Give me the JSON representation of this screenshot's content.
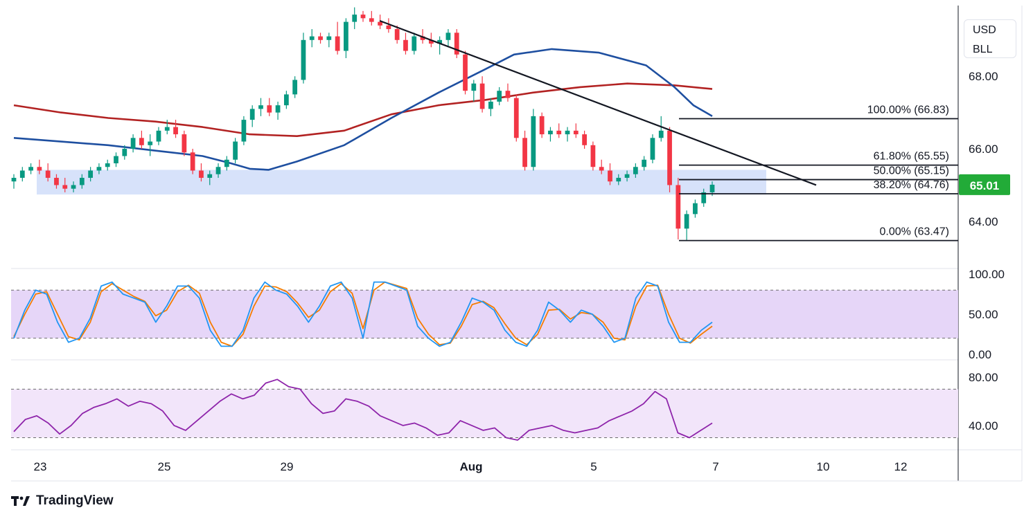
{
  "currency_badge": {
    "line1": "USD",
    "line2": "BLL"
  },
  "brand": {
    "name": "TradingView",
    "logo_icon": "tradingview-logo-icon"
  },
  "colors": {
    "up_candle": "#089981",
    "down_candle": "#f23645",
    "ma_fast": "#1e4fa0",
    "ma_slow": "#b22222",
    "support_zone": "#c9d8f8",
    "stoch_k": "#2196f3",
    "stoch_d": "#f57c00",
    "stoch_band": "#e3d1f7",
    "rsi_line": "#8e24aa",
    "rsi_band": "#f1e4fa",
    "price_label": "#22ab38"
  },
  "chart_data": [
    {
      "type": "candlestick",
      "panel": "price",
      "y_ticks": [
        "68.00",
        "66.00",
        "64.00"
      ],
      "y_range": [
        62.7,
        69.95
      ],
      "x_ticks": [
        "23",
        "25",
        "29",
        "Aug",
        "5",
        "7",
        "10",
        "12"
      ],
      "current_price": {
        "label": "65.01",
        "value": 65.01
      },
      "fib_levels": [
        {
          "label": "100.00% (66.83)",
          "value": 66.83
        },
        {
          "label": "61.80% (65.55)",
          "value": 65.55
        },
        {
          "label": "50.00% (65.15)",
          "value": 65.15
        },
        {
          "label": "38.20% (64.76)",
          "value": 64.76
        },
        {
          "label": "0.00% (63.47)",
          "value": 63.47
        }
      ],
      "support_zone": {
        "from": 64.74,
        "to": 65.42
      },
      "trendline": {
        "from": {
          "bar": 0.39,
          "value": 69.53
        },
        "to": {
          "bar": 0.85,
          "value": 65.0
        }
      },
      "ma_fast_path": [
        [
          0.0,
          66.3
        ],
        [
          0.05,
          66.2
        ],
        [
          0.1,
          66.1
        ],
        [
          0.15,
          65.95
        ],
        [
          0.2,
          65.8
        ],
        [
          0.23,
          65.6
        ],
        [
          0.25,
          65.45
        ],
        [
          0.27,
          65.42
        ],
        [
          0.3,
          65.65
        ],
        [
          0.35,
          66.1
        ],
        [
          0.4,
          66.85
        ],
        [
          0.45,
          67.55
        ],
        [
          0.5,
          68.2
        ],
        [
          0.53,
          68.6
        ],
        [
          0.57,
          68.75
        ],
        [
          0.62,
          68.65
        ],
        [
          0.67,
          68.3
        ],
        [
          0.7,
          67.7
        ],
        [
          0.72,
          67.2
        ],
        [
          0.74,
          66.9
        ]
      ],
      "ma_slow_path": [
        [
          0.0,
          67.2
        ],
        [
          0.05,
          67.0
        ],
        [
          0.1,
          66.85
        ],
        [
          0.15,
          66.75
        ],
        [
          0.2,
          66.6
        ],
        [
          0.25,
          66.4
        ],
        [
          0.3,
          66.35
        ],
        [
          0.35,
          66.5
        ],
        [
          0.4,
          66.95
        ],
        [
          0.45,
          67.2
        ],
        [
          0.5,
          67.35
        ],
        [
          0.55,
          67.55
        ],
        [
          0.6,
          67.7
        ],
        [
          0.65,
          67.8
        ],
        [
          0.7,
          67.75
        ],
        [
          0.74,
          67.65
        ]
      ],
      "candles": [
        [
          65.1,
          65.3,
          64.9,
          65.2
        ],
        [
          65.2,
          65.5,
          65.1,
          65.4
        ],
        [
          65.4,
          65.6,
          65.3,
          65.5
        ],
        [
          65.5,
          65.7,
          65.3,
          65.4
        ],
        [
          65.4,
          65.6,
          65.1,
          65.2
        ],
        [
          65.2,
          65.3,
          64.9,
          65.0
        ],
        [
          65.0,
          65.2,
          64.8,
          64.9
        ],
        [
          64.9,
          65.1,
          64.8,
          65.0
        ],
        [
          65.0,
          65.3,
          64.9,
          65.2
        ],
        [
          65.2,
          65.5,
          65.1,
          65.4
        ],
        [
          65.4,
          65.6,
          65.3,
          65.5
        ],
        [
          65.5,
          65.7,
          65.4,
          65.6
        ],
        [
          65.6,
          65.9,
          65.5,
          65.8
        ],
        [
          65.8,
          66.1,
          65.7,
          66.0
        ],
        [
          66.0,
          66.4,
          65.9,
          66.3
        ],
        [
          66.3,
          66.5,
          66.0,
          66.1
        ],
        [
          66.1,
          66.4,
          65.8,
          66.2
        ],
        [
          66.2,
          66.6,
          66.1,
          66.5
        ],
        [
          66.5,
          66.8,
          66.4,
          66.6
        ],
        [
          66.6,
          66.8,
          66.3,
          66.4
        ],
        [
          66.4,
          66.5,
          65.8,
          65.9
        ],
        [
          65.9,
          66.0,
          65.3,
          65.4
        ],
        [
          65.4,
          65.6,
          65.1,
          65.2
        ],
        [
          65.2,
          65.4,
          65.0,
          65.3
        ],
        [
          65.3,
          65.6,
          65.2,
          65.5
        ],
        [
          65.5,
          65.8,
          65.4,
          65.7
        ],
        [
          65.7,
          66.3,
          65.6,
          66.2
        ],
        [
          66.2,
          66.9,
          66.1,
          66.8
        ],
        [
          66.8,
          67.2,
          66.6,
          67.1
        ],
        [
          67.1,
          67.4,
          66.9,
          67.2
        ],
        [
          67.2,
          67.4,
          66.9,
          67.0
        ],
        [
          67.0,
          67.3,
          66.8,
          67.2
        ],
        [
          67.2,
          67.6,
          67.1,
          67.5
        ],
        [
          67.5,
          68.0,
          67.4,
          67.9
        ],
        [
          67.9,
          69.2,
          67.8,
          69.0
        ],
        [
          69.0,
          69.3,
          68.8,
          69.1
        ],
        [
          69.1,
          69.2,
          68.9,
          69.0
        ],
        [
          69.0,
          69.2,
          68.8,
          69.1
        ],
        [
          69.1,
          69.5,
          68.6,
          68.7
        ],
        [
          68.7,
          69.6,
          68.5,
          69.5
        ],
        [
          69.5,
          69.9,
          69.3,
          69.7
        ],
        [
          69.7,
          69.8,
          69.5,
          69.6
        ],
        [
          69.6,
          69.8,
          69.4,
          69.5
        ],
        [
          69.5,
          69.7,
          69.3,
          69.4
        ],
        [
          69.4,
          69.6,
          69.2,
          69.3
        ],
        [
          69.3,
          69.4,
          68.9,
          69.0
        ],
        [
          69.0,
          69.2,
          68.6,
          68.7
        ],
        [
          68.7,
          69.2,
          68.6,
          69.1
        ],
        [
          69.1,
          69.3,
          68.9,
          69.0
        ],
        [
          69.0,
          69.2,
          68.8,
          68.9
        ],
        [
          68.9,
          69.1,
          68.6,
          69.0
        ],
        [
          69.0,
          69.3,
          68.8,
          69.2
        ],
        [
          69.2,
          69.3,
          68.5,
          68.6
        ],
        [
          68.6,
          68.7,
          67.5,
          67.6
        ],
        [
          67.6,
          67.9,
          67.3,
          67.8
        ],
        [
          67.8,
          68.0,
          67.0,
          67.1
        ],
        [
          67.1,
          67.4,
          66.9,
          67.3
        ],
        [
          67.3,
          67.7,
          67.2,
          67.6
        ],
        [
          67.6,
          67.8,
          67.3,
          67.4
        ],
        [
          67.4,
          67.5,
          66.2,
          66.3
        ],
        [
          66.3,
          66.5,
          65.4,
          65.5
        ],
        [
          65.5,
          67.1,
          65.4,
          66.9
        ],
        [
          66.9,
          67.0,
          66.3,
          66.4
        ],
        [
          66.4,
          66.6,
          66.2,
          66.5
        ],
        [
          66.5,
          66.7,
          66.3,
          66.4
        ],
        [
          66.4,
          66.6,
          66.2,
          66.5
        ],
        [
          66.5,
          66.7,
          66.3,
          66.4
        ],
        [
          66.4,
          66.5,
          66.0,
          66.1
        ],
        [
          66.1,
          66.2,
          65.4,
          65.5
        ],
        [
          65.5,
          65.7,
          65.3,
          65.4
        ],
        [
          65.4,
          65.6,
          65.0,
          65.1
        ],
        [
          65.1,
          65.3,
          65.0,
          65.2
        ],
        [
          65.2,
          65.4,
          65.1,
          65.3
        ],
        [
          65.3,
          65.6,
          65.2,
          65.5
        ],
        [
          65.5,
          65.8,
          65.4,
          65.7
        ],
        [
          65.7,
          66.4,
          65.6,
          66.3
        ],
        [
          66.3,
          66.9,
          66.2,
          66.5
        ],
        [
          66.5,
          66.6,
          64.8,
          65.0
        ],
        [
          65.0,
          65.2,
          63.5,
          63.8
        ],
        [
          63.8,
          64.3,
          63.47,
          64.2
        ],
        [
          64.2,
          64.6,
          64.1,
          64.5
        ],
        [
          64.5,
          64.9,
          64.4,
          64.8
        ],
        [
          64.8,
          65.1,
          64.7,
          65.01
        ]
      ]
    },
    {
      "type": "line",
      "panel": "stochastic",
      "y_ticks": [
        "100.00",
        "50.00",
        "0.00"
      ],
      "y_range": [
        0,
        100
      ],
      "band": {
        "upper": 80,
        "lower": 20
      },
      "series": [
        {
          "key": "k",
          "values": [
            20,
            55,
            80,
            75,
            40,
            15,
            20,
            45,
            85,
            90,
            75,
            70,
            65,
            40,
            60,
            85,
            85,
            70,
            30,
            10,
            10,
            30,
            70,
            90,
            80,
            75,
            60,
            40,
            60,
            85,
            90,
            70,
            20,
            90,
            90,
            85,
            80,
            35,
            20,
            10,
            15,
            40,
            70,
            65,
            55,
            30,
            15,
            10,
            30,
            65,
            55,
            40,
            55,
            50,
            35,
            15,
            20,
            70,
            90,
            85,
            40,
            15,
            15,
            30,
            40
          ]
        },
        {
          "key": "d",
          "values": [
            22,
            50,
            75,
            78,
            50,
            22,
            18,
            40,
            78,
            88,
            80,
            72,
            66,
            48,
            55,
            78,
            86,
            76,
            40,
            15,
            10,
            25,
            60,
            85,
            84,
            78,
            64,
            46,
            55,
            78,
            88,
            76,
            32,
            80,
            90,
            86,
            82,
            45,
            25,
            12,
            14,
            35,
            62,
            66,
            58,
            38,
            20,
            12,
            25,
            55,
            56,
            44,
            52,
            50,
            40,
            20,
            18,
            60,
            85,
            86,
            50,
            20,
            14,
            25,
            35
          ]
        }
      ]
    },
    {
      "type": "line",
      "panel": "rsi",
      "y_ticks": [
        "80.00",
        "40.00"
      ],
      "y_range": [
        20,
        93
      ],
      "band": {
        "upper": 70,
        "lower": 30
      },
      "series": [
        {
          "key": "rsi",
          "values": [
            35,
            45,
            48,
            42,
            33,
            40,
            50,
            55,
            58,
            62,
            56,
            60,
            58,
            52,
            40,
            36,
            44,
            52,
            60,
            66,
            62,
            65,
            75,
            78,
            72,
            70,
            58,
            50,
            52,
            62,
            60,
            56,
            48,
            44,
            40,
            42,
            38,
            32,
            34,
            44,
            40,
            36,
            38,
            30,
            28,
            36,
            38,
            40,
            36,
            34,
            36,
            38,
            44,
            48,
            52,
            58,
            68,
            62,
            34,
            30,
            36,
            42
          ]
        }
      ]
    }
  ]
}
